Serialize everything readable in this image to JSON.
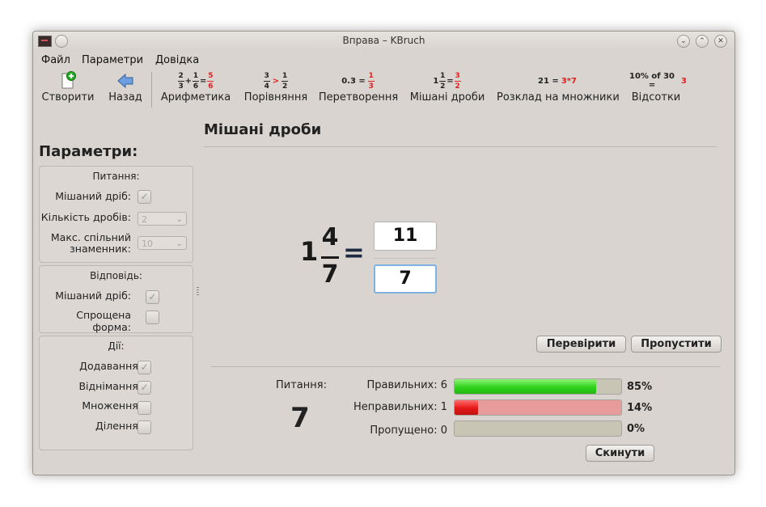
{
  "window": {
    "title": "Вправа – KBruch"
  },
  "menu": {
    "items": [
      "Файл",
      "Параметри",
      "Довідка"
    ]
  },
  "toolbar": {
    "new": "Створити",
    "back": "Назад",
    "arithmetic": "Арифметика",
    "comparison": "Порівняння",
    "conversion": "Перетворення",
    "mixed": "Мішані дроби",
    "factorization": "Розклад на множники",
    "percentage": "Відсотки",
    "icons": {
      "arith": {
        "a_num": "2",
        "a_den": "3",
        "op": "+",
        "b_num": "1",
        "b_den": "6",
        "eq": "=",
        "r_num": "5",
        "r_den": "6"
      },
      "comp": {
        "a_num": "3",
        "a_den": "4",
        "op": ">",
        "b_num": "1",
        "b_den": "2"
      },
      "conv": {
        "left": "0.3 =",
        "r_num": "1",
        "r_den": "3"
      },
      "mixed": {
        "whole": "1",
        "a_num": "1",
        "a_den": "2",
        "eq": "=",
        "r_num": "3",
        "r_den": "2"
      },
      "factor": {
        "left": "21 =",
        "right": "3*7"
      },
      "percent": {
        "left": "10% of 30 =",
        "right": "3"
      }
    }
  },
  "page_title": "Мішані дроби",
  "options": {
    "title": "Параметри:",
    "question": {
      "title": "Питання:",
      "mixed_label": "Мішаний дріб:",
      "mixed_checked": true,
      "count_label": "Кількість дробів:",
      "count_value": "2",
      "maxden_label_1": "Макс. спільний",
      "maxden_label_2": "знаменник:",
      "maxden_value": "10"
    },
    "answer": {
      "title": "Відповідь:",
      "mixed_label": "Мішаний дріб:",
      "mixed_checked": true,
      "reduced_label": "Спрощена форма:",
      "reduced_checked": false
    },
    "operations": {
      "title": "Дії:",
      "add_label": "Додавання:",
      "add_checked": true,
      "sub_label": "Віднімання:",
      "sub_checked": true,
      "mul_label": "Множення:",
      "mul_checked": false,
      "div_label": "Ділення:",
      "div_checked": false
    }
  },
  "task": {
    "whole": "1",
    "numerator": "4",
    "denominator": "7",
    "equals": "=",
    "answer_numerator": "11",
    "answer_denominator": "7"
  },
  "buttons": {
    "check": "Перевірити",
    "skip": "Пропустити",
    "reset": "Скинути"
  },
  "stats": {
    "questions_label": "Питання:",
    "questions_count": "7",
    "correct_label": "Правильних: 6",
    "correct_pct": "85%",
    "correct_fraction": 0.85,
    "incorrect_label": "Неправильних: 1",
    "incorrect_pct": "14%",
    "incorrect_fraction": 0.14,
    "skipped_label": "Пропущено: 0",
    "skipped_pct": "0%",
    "skipped_fraction": 0
  },
  "colors": {
    "window_bg": "#d9d4cf",
    "correct_bar": "#2fd21a",
    "incorrect_bar": "#e51818",
    "highlight_red": "#e02020",
    "focus_border": "#7fb2e0"
  }
}
